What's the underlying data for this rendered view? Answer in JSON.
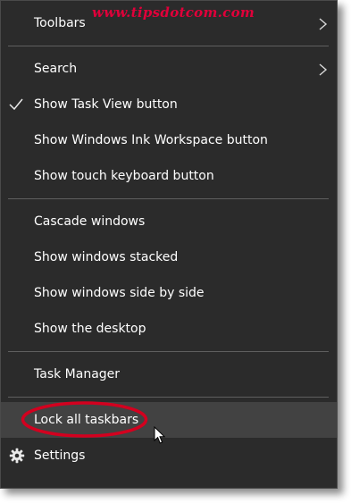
{
  "watermark": "www.tipsdotcom.com",
  "menu": {
    "toolbars": "Toolbars",
    "search": "Search",
    "show_task_view": "Show Task View button",
    "show_ink_workspace": "Show Windows Ink Workspace button",
    "show_touch_keyboard": "Show touch keyboard button",
    "cascade": "Cascade windows",
    "stacked": "Show windows stacked",
    "side_by_side": "Show windows side by side",
    "show_desktop": "Show the desktop",
    "task_manager": "Task Manager",
    "lock_taskbars": "Lock all taskbars",
    "settings": "Settings"
  },
  "icons": {
    "check": "check-icon",
    "chevron": "chevron-right-icon",
    "gear": "gear-icon",
    "cursor": "mouse-pointer-icon"
  },
  "colors": {
    "menu_bg": "#2b2b2b",
    "hover_bg": "#424242",
    "separator": "#5f5f5f",
    "text": "#ffffff",
    "annotation": "#d3001f"
  }
}
